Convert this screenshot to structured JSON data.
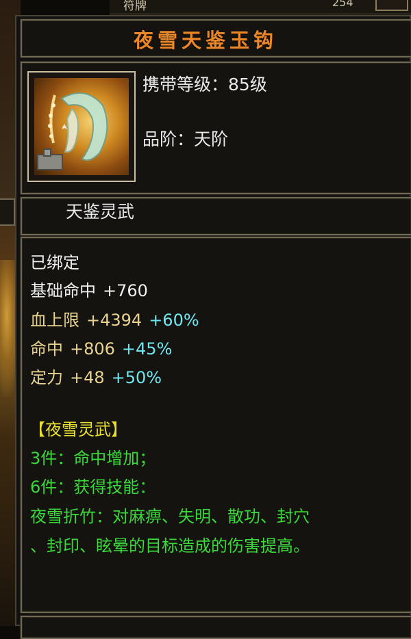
{
  "top_bar": {
    "left_text": "符牌",
    "right_text": "254"
  },
  "item": {
    "name": "夜雪天鉴玉钩",
    "carry_level_label": "携带等级：",
    "carry_level_value": "85级",
    "grade_label": "品阶：",
    "grade_value": "天阶",
    "category": "天鉴灵武"
  },
  "status": "已绑定",
  "stats": [
    {
      "name": "基础命中",
      "value": "+760",
      "bonus": ""
    },
    {
      "name": "血上限",
      "value": "+4394",
      "bonus": "+60%"
    },
    {
      "name": "命中",
      "value": "+806",
      "bonus": "+45%"
    },
    {
      "name": "定力",
      "value": "+48",
      "bonus": "+50%"
    }
  ],
  "set": {
    "name": "【夜雪灵武】",
    "tier3": "3件：命中增加；",
    "tier6": "6件：获得技能：",
    "skill_line1": "夜雪折竹：对麻痹、失明、散功、封穴",
    "skill_line2": "、封印、眩晕的目标造成的伤害提高。"
  },
  "colors": {
    "title": "#e8882a",
    "stat_name": "#e8d490",
    "bonus": "#6fe6f0",
    "set_text": "#3ad83a",
    "set_name": "#e8e030"
  },
  "icons": {
    "item": "jade-hook-weapon-icon"
  }
}
